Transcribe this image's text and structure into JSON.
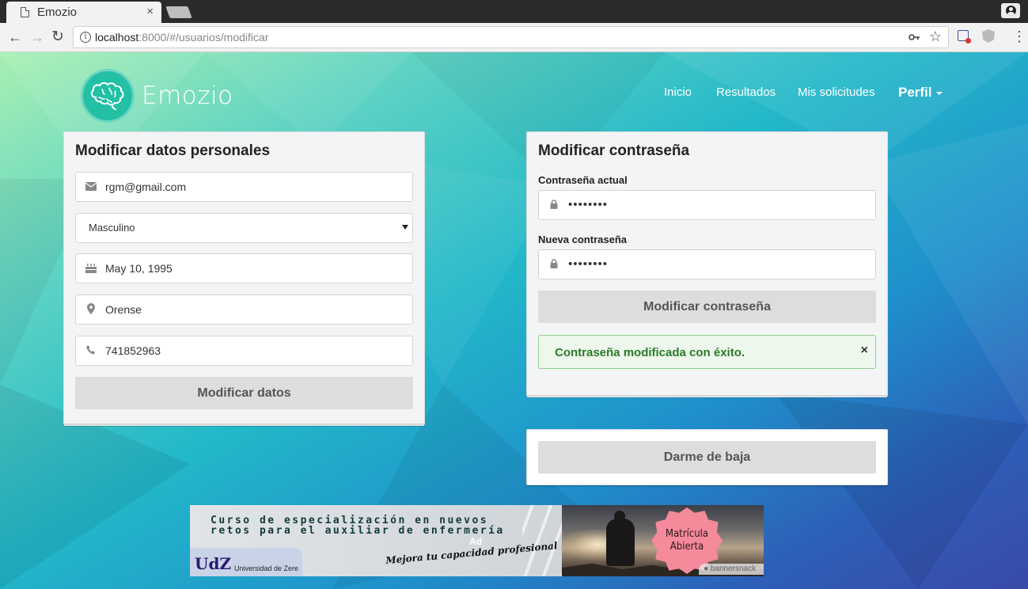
{
  "browser": {
    "tab_title": "Emozio",
    "tab_close": "×",
    "url_host": "localhost",
    "url_path": ":8000/#/usuarios/modificar"
  },
  "nav": {
    "brand": "Emozio",
    "links": [
      "Inicio",
      "Resultados",
      "Mis solicitudes"
    ],
    "profile": "Perfil"
  },
  "personal": {
    "title": "Modificar datos personales",
    "email": "rgm@gmail.com",
    "gender": "Masculino",
    "birthdate": "May 10, 1995",
    "city": "Orense",
    "phone": "741852963",
    "button": "Modificar datos"
  },
  "password": {
    "title": "Modificar contraseña",
    "current_label": "Contraseña actual",
    "current_value": "••••••••",
    "new_label": "Nueva contraseña",
    "new_value": "••••••••",
    "button": "Modificar contraseña",
    "alert": "Contraseña modificada con éxito.",
    "alert_close": "×"
  },
  "unsubscribe": {
    "button": "Darme de baja"
  },
  "ad": {
    "line1": "Curso de especialización en nuevos",
    "line2": "retos para el auxiliar de enfermería",
    "tag": "Ad",
    "slogan": "Mejora tu capacidad profesional !!",
    "udz": "UdZ",
    "university": "Universidad de Zere",
    "badge_line1": "Matrícula",
    "badge_line2": "Abierta",
    "provider": "bannersnack"
  }
}
